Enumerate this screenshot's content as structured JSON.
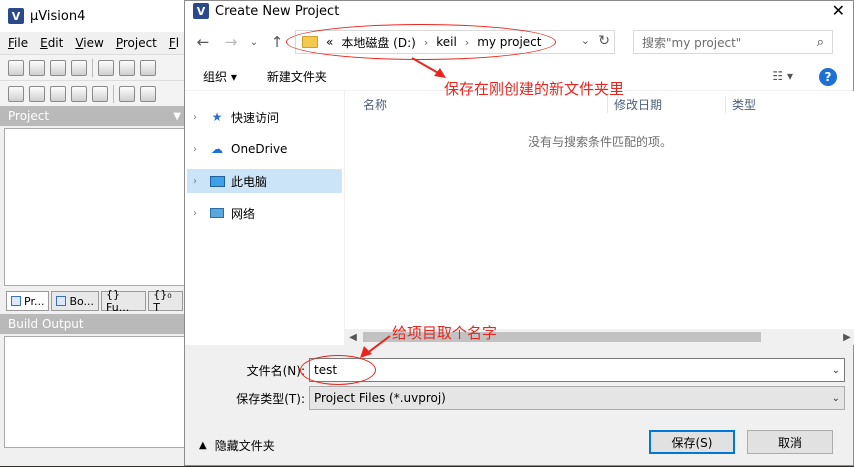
{
  "bg_app": {
    "title": "µVision4",
    "menu": [
      "File",
      "Edit",
      "View",
      "Project",
      "Fl"
    ],
    "project_panel_title": "Project",
    "tabs": [
      "Pr...",
      "Bo...",
      "{} Fu...",
      "{}₀ T"
    ],
    "build_output_title": "Build Output"
  },
  "dialog": {
    "title": "Create New Project",
    "close_glyph": "✕",
    "breadcrumb": [
      "«",
      "本地磁盘 (D:)",
      "keil",
      "my project"
    ],
    "search_placeholder": "搜索\"my project\"",
    "toolbar": {
      "organize": "组织 ▾",
      "new_folder": "新建文件夹"
    },
    "nav": [
      {
        "label": "快速访问"
      },
      {
        "label": "OneDrive"
      },
      {
        "label": "此电脑"
      },
      {
        "label": "网络"
      }
    ],
    "columns": {
      "name": "名称",
      "modified": "修改日期",
      "type": "类型"
    },
    "empty_message": "没有与搜索条件匹配的项。",
    "filename_label": "文件名(N):",
    "filename_value": "test",
    "filetype_label": "保存类型(T):",
    "filetype_value": "Project Files (*.uvproj)",
    "hide_folders": "隐藏文件夹",
    "save_button": "保存(S)",
    "cancel_button": "取消"
  },
  "annotations": {
    "save_location": "保存在刚创建的新文件夹里",
    "name_project": "给项目取个名字"
  },
  "colors": {
    "annotation": "#e8261f",
    "selection": "#cce4f7",
    "help": "#1e6fd6"
  }
}
